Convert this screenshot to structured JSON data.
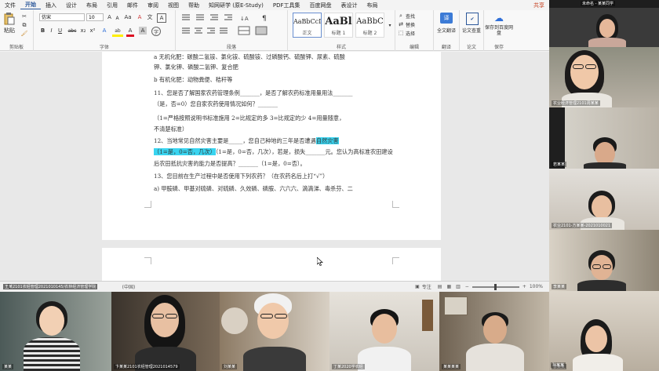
{
  "menu": {
    "tabs": [
      "文件",
      "开始",
      "插入",
      "设计",
      "布局",
      "引用",
      "邮件",
      "审阅",
      "视图",
      "帮助",
      "知网研学 (原E-Study)",
      "PDF工具集",
      "百度网盘",
      "表设计",
      "布局"
    ],
    "share_label": "共享"
  },
  "ribbon": {
    "clipboard": {
      "paste_label": "粘贴",
      "group_label": "剪贴板"
    },
    "font": {
      "font_name": "仿宋",
      "font_size": "10",
      "group_label": "字体",
      "bold": "B",
      "italic": "I",
      "underline": "U",
      "strike": "abc",
      "sub": "x₂",
      "sup": "x²",
      "grow": "A",
      "shrink": "A",
      "case": "Aa",
      "clear": "A",
      "phonetic": "文",
      "highlight": "ab",
      "color": "A",
      "shade": "A",
      "border": "A"
    },
    "paragraph": {
      "group_label": "段落"
    },
    "styles": {
      "group_label": "样式",
      "items": [
        {
          "preview": "AaBbCcI",
          "name": "正文"
        },
        {
          "preview": "AaBl",
          "name": "标题 1"
        },
        {
          "preview": "AaBbC",
          "name": "标题 2"
        }
      ]
    },
    "editing": {
      "group_label": "编辑",
      "find": "查找",
      "replace": "替换",
      "select": "选择"
    },
    "translate": {
      "group_label": "翻译",
      "label": "全文翻译"
    },
    "paper": {
      "group_label": "论文",
      "label": "论文查重"
    },
    "save": {
      "group_label": "保存",
      "label": "保存到百度网盘"
    }
  },
  "document": {
    "lines": [
      "a 无机化肥：碳酸二氢铵、氯化铵、硫酸铵、过磷酸钙、硫酸钾、尿素、硫酸",
      "钾、氯化钾、磷酸二氢钾、复合肥",
      "b 有机化肥：动物粪便、秸秆等",
      "11、您是否了解国家农药管理条例_______，是否了解农药标准用量用法_______",
      "（是，否=0）您自家农药使用情况如何？_______",
      "（1=严格按照说明书标准施用  2=比规定的多  3=比规定的少  4=用量随意，",
      "不清楚标准）",
      "12、当地常见自然灾害主要是_____，您自己种地的三年是否遭遇",
      "（1=是，0=否，几次），若是，损失_______元。您认为高标准农田建设",
      "后农田抵抗灾害的能力是否提高？_______（1=是，0=否）。",
      "13、您目前在生产过程中是否使用下列农药？（在农药名后上打“√”）",
      "a) 甲胺磷、甲基对硫磷、对硫磷、久效磷、磷胺、六六六、滴滴涕、毒杀芬、二"
    ],
    "highlight_1": "自然灾害",
    "highlight_2": "（1=是，0=否，几次）"
  },
  "status": {
    "language": "(中国)",
    "focus_label": "专注",
    "zoom": "100%"
  },
  "participants": {
    "right": [
      "未命名 - 某某同学",
      "农业经济管理2101周某某",
      "若某某",
      "李某某",
      "农业2101-方某某-2021010021",
      "李某某"
    ],
    "bottom": [
      "王某2101农经管理2021010145/农林经济管理学院",
      "某某",
      "卞某某2101农经管理2021014579",
      "刘某某",
      "丁某2020学农经",
      "某某某某",
      "孙某某"
    ]
  }
}
